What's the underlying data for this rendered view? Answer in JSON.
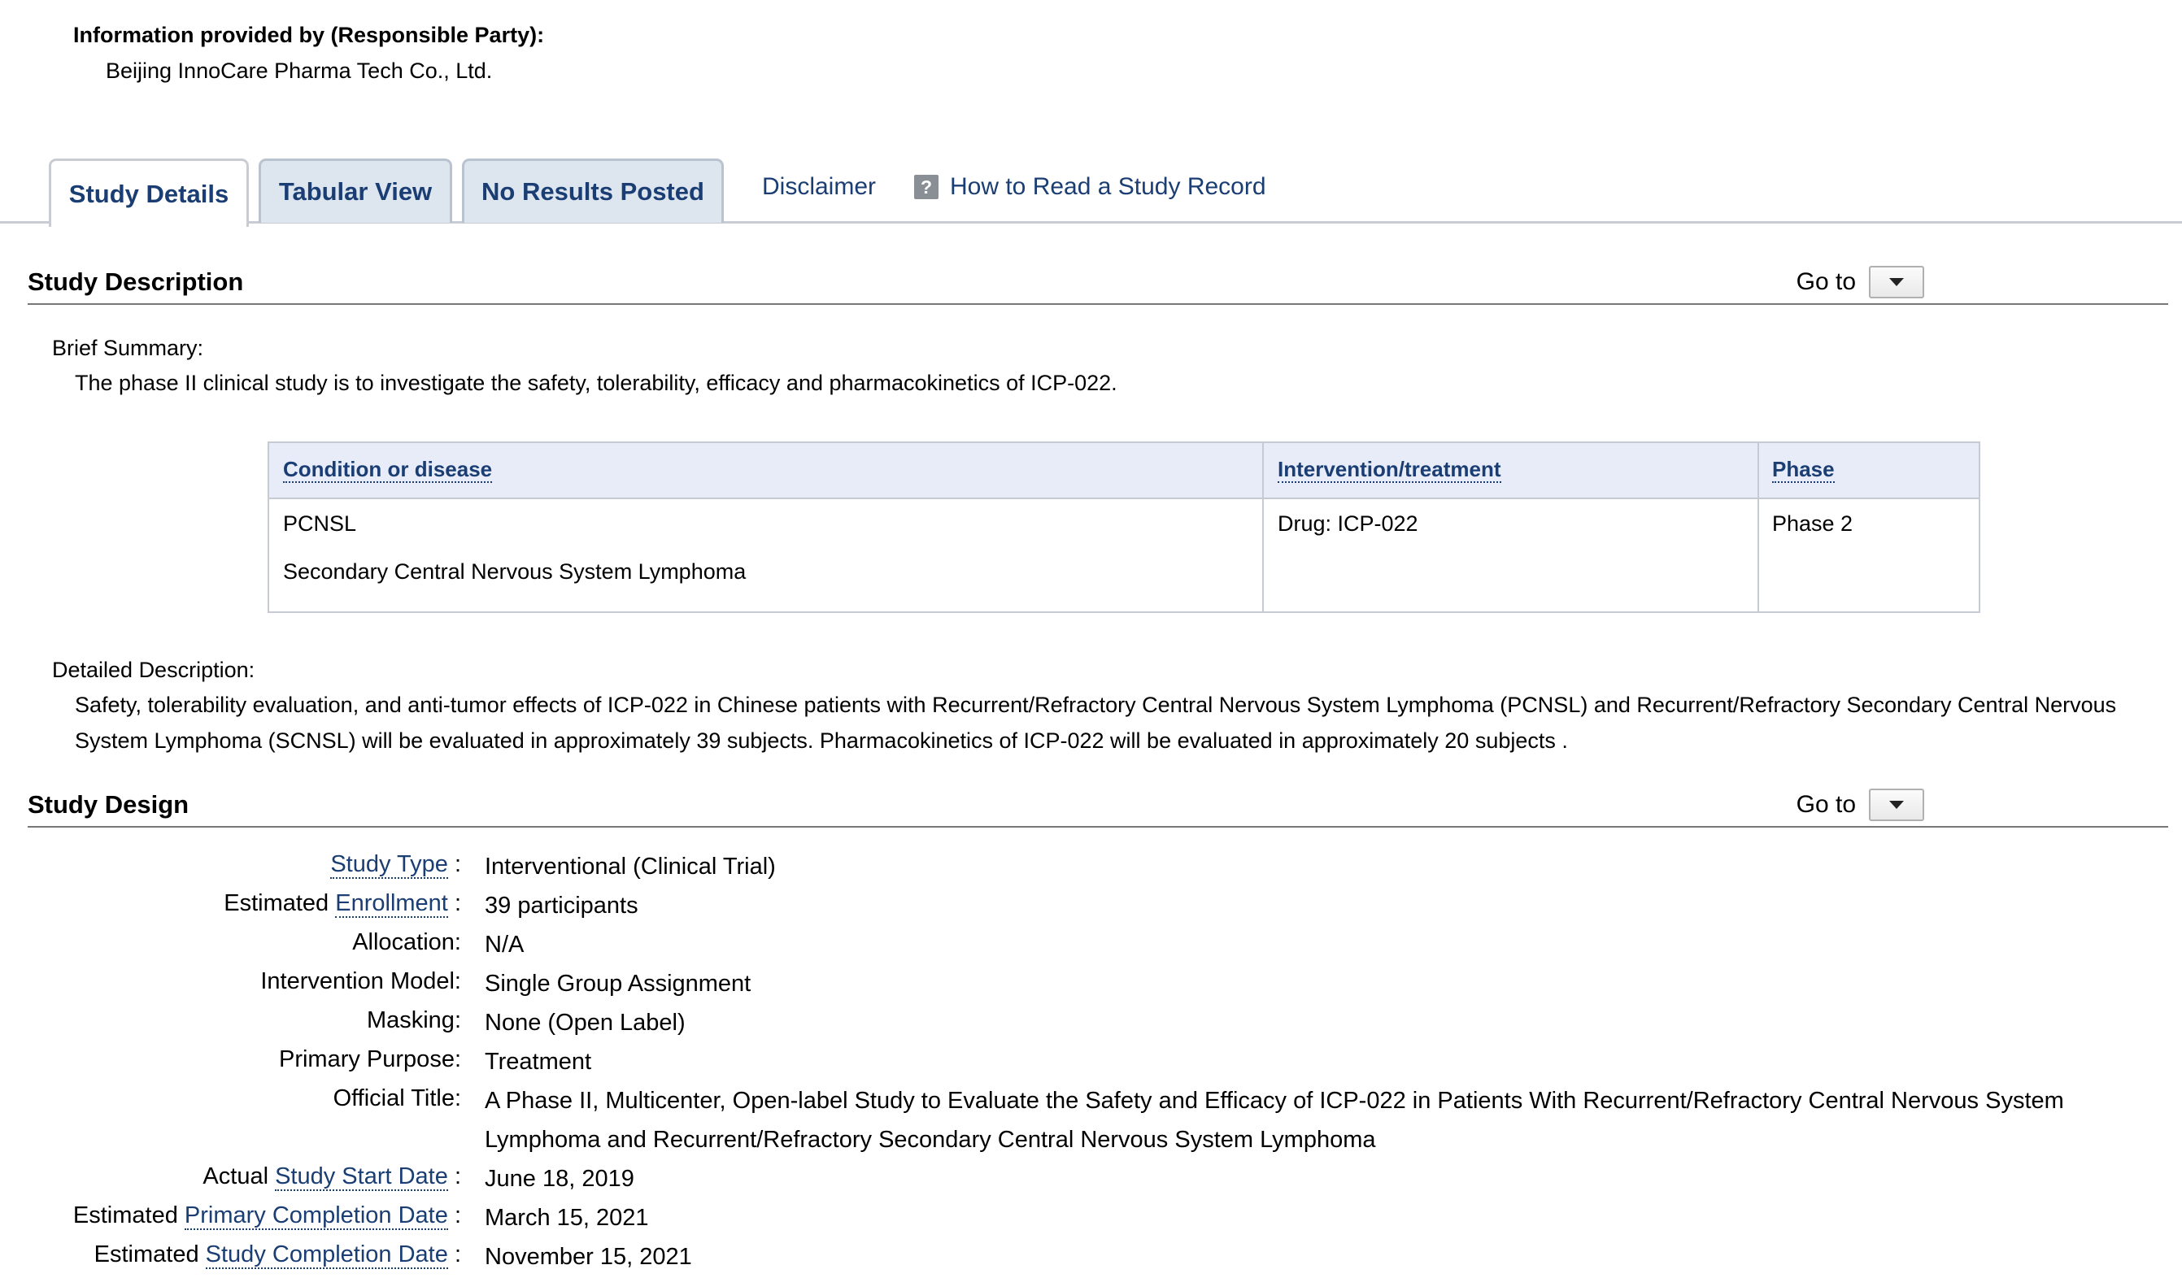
{
  "responsible_party": {
    "label": "Information provided by (Responsible Party):",
    "value": "Beijing InnoCare Pharma Tech Co., Ltd."
  },
  "tabs": {
    "study_details": "Study Details",
    "tabular_view": "Tabular View",
    "no_results": "No Results Posted",
    "disclaimer": "Disclaimer",
    "help_icon_glyph": "?",
    "how_to_read": "How to Read a Study Record"
  },
  "study_description": {
    "title": "Study Description",
    "goto_label": "Go to",
    "brief_summary_label": "Brief Summary:",
    "brief_summary": "The phase II clinical study is to investigate the safety, tolerability, efficacy and pharmacokinetics of ICP-022.",
    "table": {
      "headers": [
        "Condition or disease",
        "Intervention/treatment",
        "Phase"
      ],
      "conditions": [
        "PCNSL",
        "Secondary Central Nervous System Lymphoma"
      ],
      "intervention": "Drug: ICP-022",
      "phase": "Phase 2"
    },
    "detailed_label": "Detailed Description:",
    "detailed_line1": "Safety, tolerability evaluation, and anti-tumor effects of ICP-022 in Chinese patients with Recurrent/Refractory Central Nervous System Lymphoma (PCNSL) and Recurrent/Refractory Secondary Central Nervous",
    "detailed_line2": "System Lymphoma (SCNSL) will be evaluated in approximately 39 subjects. Pharmacokinetics of ICP-022 will be evaluated in approximately 20 subjects ."
  },
  "study_design": {
    "title": "Study Design",
    "goto_label": "Go to",
    "study_type_label": "Study Type",
    "study_type": "Interventional  (Clinical Trial)",
    "enrollment_prefix": "Estimated",
    "enrollment_label": "Enrollment",
    "enrollment": "39 participants",
    "allocation_label": "Allocation:",
    "allocation": "N/A",
    "intervention_model_label": "Intervention Model:",
    "intervention_model": "Single Group Assignment",
    "masking_label": "Masking:",
    "masking": "None (Open Label)",
    "primary_purpose_label": "Primary Purpose:",
    "primary_purpose": "Treatment",
    "official_title_label": "Official Title:",
    "official_title_line1": "A Phase II, Multicenter, Open-label Study to Evaluate the Safety and Efficacy of ICP-022 in Patients With Recurrent/Refractory Central Nervous System",
    "official_title_line2": "Lymphoma and Recurrent/Refractory Secondary Central Nervous System Lymphoma",
    "start_prefix": "Actual",
    "start_label": "Study Start Date",
    "start_date": "June 18, 2019",
    "primary_completion_prefix": "Estimated",
    "primary_completion_label": "Primary Completion Date",
    "primary_completion": "March 15, 2021",
    "completion_prefix": "Estimated",
    "completion_label": "Study Completion Date",
    "completion": "November 15, 2021",
    "colon": ":"
  }
}
